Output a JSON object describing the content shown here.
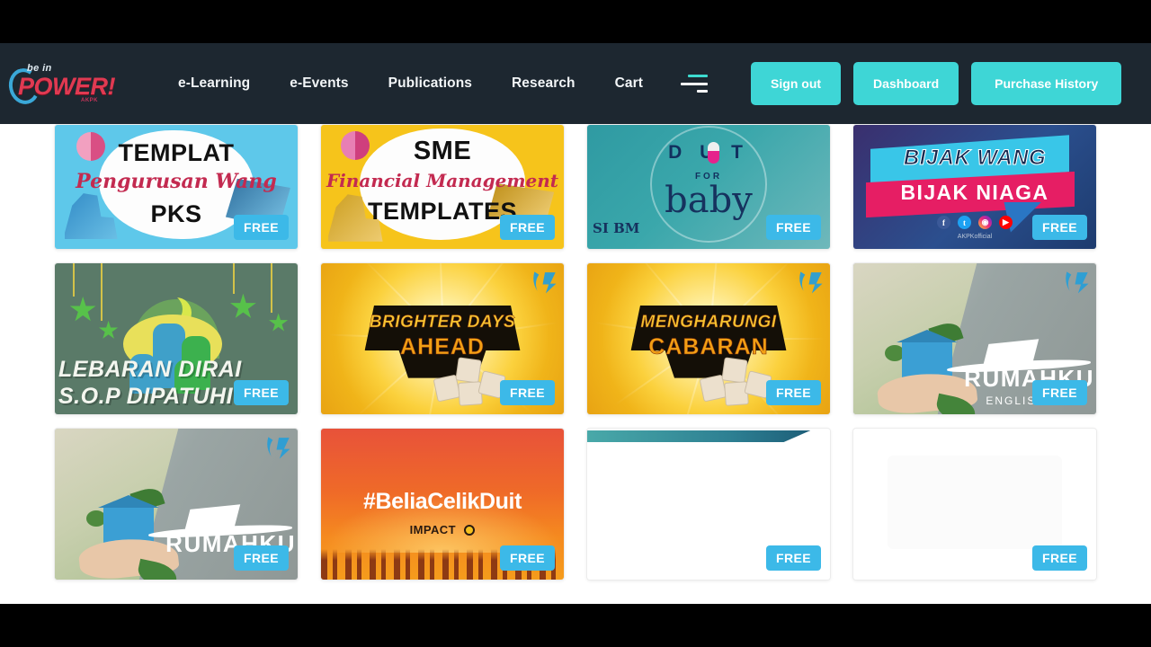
{
  "site": {
    "logo": {
      "line1": "be in",
      "line2": "POWER!",
      "mark": "AKPK"
    }
  },
  "nav": {
    "links": [
      {
        "label": "e-Learning",
        "name": "nav-link-elearning"
      },
      {
        "label": "e-Events",
        "name": "nav-link-eevents"
      },
      {
        "label": "Publications",
        "name": "nav-link-publications"
      },
      {
        "label": "Research",
        "name": "nav-link-research"
      },
      {
        "label": "Cart",
        "name": "nav-link-cart"
      }
    ],
    "menu_icon": "hamburger-menu-icon",
    "buttons": [
      {
        "label": "Sign out",
        "name": "sign-out-button"
      },
      {
        "label": "Dashboard",
        "name": "dashboard-button"
      },
      {
        "label": "Purchase History",
        "name": "purchase-history-button"
      }
    ]
  },
  "colors": {
    "navbar_bg": "#1d2730",
    "button_teal": "#3ed6d6",
    "badge_blue": "#3cb9e8",
    "page_bg": "#ffffff",
    "logo_red": "#e03a52",
    "logo_blue": "#3aa8d8",
    "hamburger_accent": "#3ddbcf"
  },
  "badges": {
    "free": "FREE"
  },
  "cards": [
    {
      "name": "card-templat-pengurusan-wang-pks",
      "art": "templat",
      "title_line1": "TEMPLAT",
      "title_line2": "Pengurusan Wang",
      "title_line3": "PKS",
      "badge": "FREE"
    },
    {
      "name": "card-sme-financial-management-templates",
      "art": "sme",
      "title_line1": "SME",
      "title_line2": "Financial Management",
      "title_line3": "TEMPLATES",
      "badge": "FREE"
    },
    {
      "name": "card-duit-for-baby",
      "art": "baby",
      "title_line1": "D U  T",
      "title_line2": "FOR",
      "title_line3": "baby",
      "corner_text": "SI BM",
      "badge": "FREE"
    },
    {
      "name": "card-bijak-wang-bijak-niaga",
      "art": "bijak",
      "title_line1": "BIJAK WANG",
      "title_line2": "BIJAK NIAGA",
      "handle": "AKPKofficial",
      "socials": [
        "facebook-icon",
        "twitter-icon",
        "instagram-icon",
        "youtube-icon"
      ],
      "badge": "FREE"
    },
    {
      "name": "card-lebaran-dirai-sop-dipatuhi",
      "art": "lebaran",
      "title_line1": "LEBARAN DIRAI",
      "title_line2": "S.O.P DIPATUHI",
      "badge": "FREE"
    },
    {
      "name": "card-brighter-days-ahead",
      "art": "burst",
      "title_line1": "BRIGHTER DAYS",
      "title_line2": "AHEAD",
      "badge": "FREE"
    },
    {
      "name": "card-mengharungi-cabaran",
      "art": "burst",
      "title_line1": "MENGHARUNGI",
      "title_line2": "CABARAN",
      "badge": "FREE"
    },
    {
      "name": "card-rumahku-english",
      "art": "rumah",
      "title_line1": "RUMAHKU",
      "title_line2": "ENGLISH",
      "badge": "FREE"
    },
    {
      "name": "card-rumahku-second",
      "art": "rumah",
      "title_line1": "RUMAHKU",
      "title_line2": "",
      "badge": "FREE"
    },
    {
      "name": "card-belia-celik-duit",
      "art": "belia",
      "title_line1": "#BeliaCelikDuit",
      "title_line2": "IMPACT",
      "badge": "FREE"
    },
    {
      "name": "card-blank-teal-banner",
      "art": "blank",
      "title_line1": "",
      "title_line2": "",
      "badge": "FREE"
    },
    {
      "name": "card-blank-white",
      "art": "faint",
      "title_line1": "",
      "title_line2": "",
      "badge": "FREE"
    }
  ]
}
